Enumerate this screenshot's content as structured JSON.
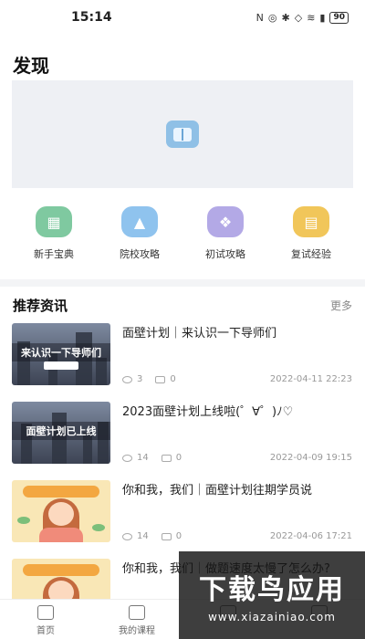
{
  "status_bar": {
    "time": "15:14",
    "battery": "90"
  },
  "page": {
    "title": "发现"
  },
  "quick_links": [
    {
      "label": "新手宝典",
      "icon": "book-icon",
      "color": "#7fc9a0"
    },
    {
      "label": "院校攻略",
      "icon": "graduation-cap-icon",
      "color": "#8fc3ee"
    },
    {
      "label": "初试攻略",
      "icon": "compass-icon",
      "color": "#b3a9e6"
    },
    {
      "label": "复试经验",
      "icon": "documents-icon",
      "color": "#f1c65a"
    }
  ],
  "news_section": {
    "title": "推荐资讯",
    "more": "更多"
  },
  "news": [
    {
      "title": "面壁计划｜来认识一下导师们",
      "thumb_caption": "来认识一下导师们",
      "views": "3",
      "comments": "0",
      "date": "2022-04-11 22:23"
    },
    {
      "title": "2023面壁计划上线啦(゜∀゜)ﾉ♡",
      "thumb_caption": "面壁计划已上线",
      "views": "14",
      "comments": "0",
      "date": "2022-04-09 19:15"
    },
    {
      "title": "你和我，我们｜面壁计划往期学员说",
      "views": "14",
      "comments": "0",
      "date": "2022-04-06 17:21"
    },
    {
      "title": "你和我，我们｜做题速度太慢了怎么办?"
    }
  ],
  "tabs": [
    {
      "label": "首页"
    },
    {
      "label": "我的课程"
    }
  ],
  "watermark": {
    "title": "下载鸟应用",
    "url": "www.xiazainiao.com"
  }
}
